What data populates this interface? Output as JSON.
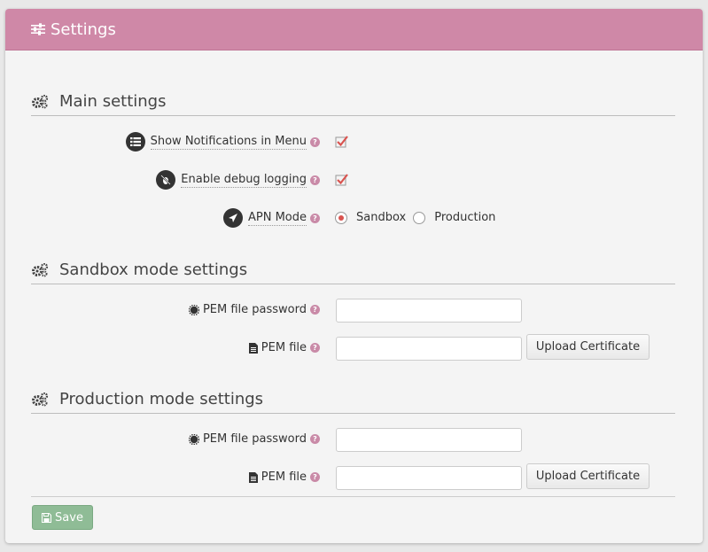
{
  "header": {
    "title": "Settings"
  },
  "sections": {
    "main": {
      "title": "Main settings"
    },
    "sandbox": {
      "title": "Sandbox mode settings"
    },
    "production": {
      "title": "Production mode settings"
    }
  },
  "main": {
    "show_notifications_label": "Show Notifications in Menu",
    "show_notifications_checked": true,
    "debug_logging_label": "Enable debug logging",
    "debug_logging_checked": true,
    "apn_mode_label": "APN Mode",
    "apn_options": [
      "Sandbox",
      "Production"
    ],
    "apn_selected": "Sandbox"
  },
  "sandbox": {
    "pem_password_label": "PEM file password",
    "pem_password_value": "",
    "pem_file_label": "PEM file",
    "pem_file_value": "",
    "upload_label": "Upload Certificate"
  },
  "production": {
    "pem_password_label": "PEM file password",
    "pem_password_value": "",
    "pem_file_label": "PEM file",
    "pem_file_value": "",
    "upload_label": "Upload Certificate"
  },
  "footer": {
    "save_label": "Save"
  },
  "help_glyph": "?",
  "colors": {
    "header": "#cf88a7",
    "accent": "#d9534f",
    "save": "#8fbc96"
  }
}
